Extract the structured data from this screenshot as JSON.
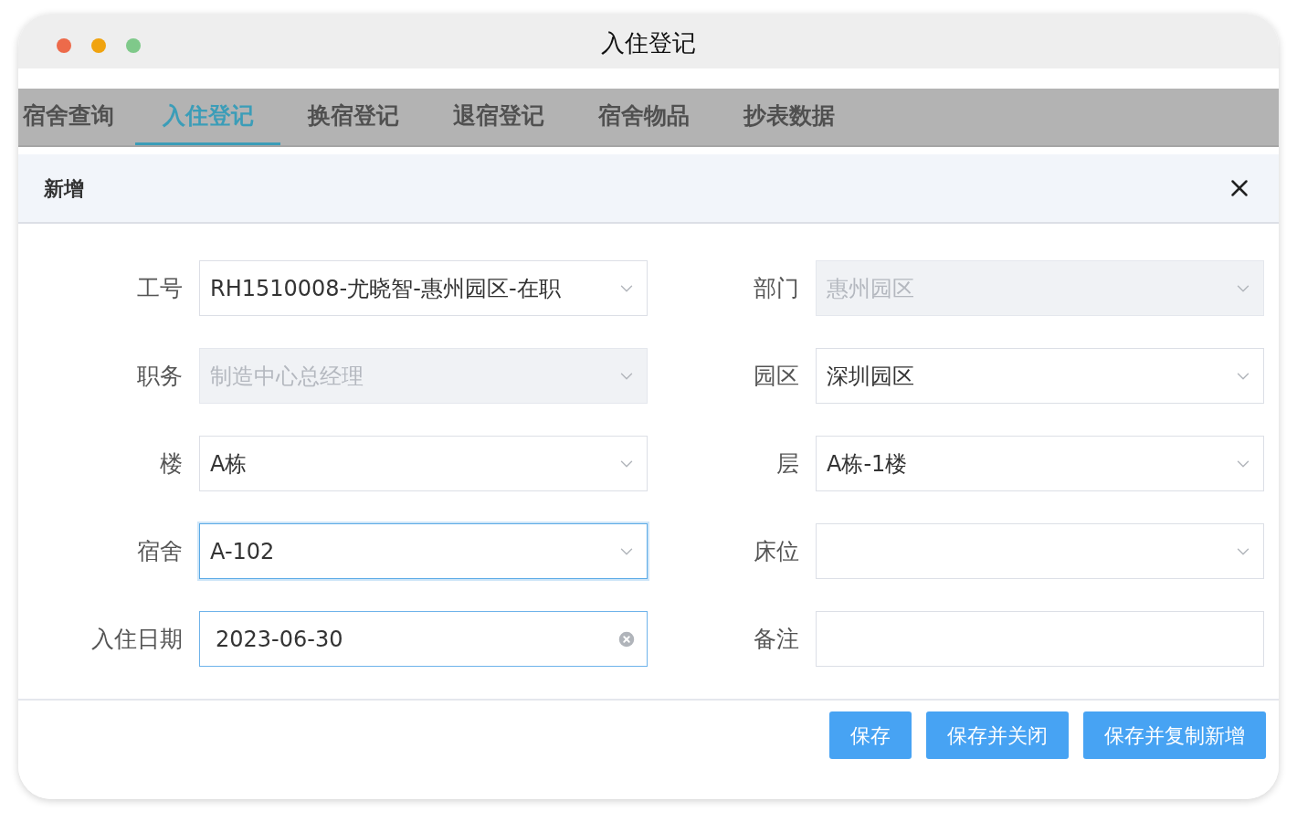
{
  "window": {
    "title": "入住登记"
  },
  "tabs": [
    {
      "label": "宿舍查询",
      "selected": false
    },
    {
      "label": "入住登记",
      "selected": true
    },
    {
      "label": "换宿登记",
      "selected": false
    },
    {
      "label": "退宿登记",
      "selected": false
    },
    {
      "label": "宿舍物品",
      "selected": false
    },
    {
      "label": "抄表数据",
      "selected": false
    }
  ],
  "dialog": {
    "title": "新增",
    "fields": [
      {
        "label": "工号",
        "kind": "select",
        "value": "RH1510008-尤晓智-惠州园区-在职",
        "disabled": false,
        "focused": false
      },
      {
        "label": "部门",
        "kind": "select",
        "value": "惠州园区",
        "disabled": true,
        "focused": false
      },
      {
        "label": "职务",
        "kind": "select",
        "value": "制造中心总经理",
        "disabled": true,
        "focused": false
      },
      {
        "label": "园区",
        "kind": "select",
        "value": "深圳园区",
        "disabled": false,
        "focused": false
      },
      {
        "label": "楼",
        "kind": "select",
        "value": "A栋",
        "disabled": false,
        "focused": false
      },
      {
        "label": "层",
        "kind": "select",
        "value": "A栋-1楼",
        "disabled": false,
        "focused": false
      },
      {
        "label": "宿舍",
        "kind": "select",
        "value": "A-102",
        "disabled": false,
        "focused": true
      },
      {
        "label": "床位",
        "kind": "select",
        "disabled": false,
        "focused": false
      },
      {
        "label": "入住日期",
        "kind": "date",
        "value": "2023-06-30",
        "disabled": false,
        "focused": false
      },
      {
        "label": "备注",
        "kind": "text",
        "disabled": false,
        "focused": false
      }
    ],
    "buttons": [
      "保存",
      "保存并关闭",
      "保存并复制新增"
    ]
  }
}
